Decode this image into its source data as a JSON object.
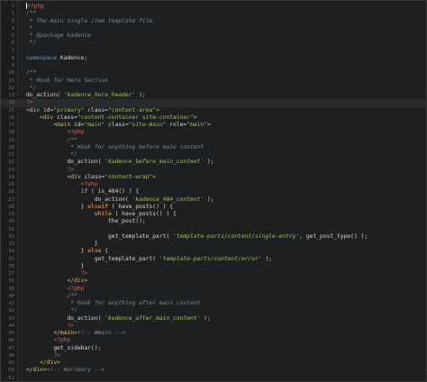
{
  "editor": {
    "lines": [
      {
        "n": "1",
        "parts": [
          {
            "c": "php",
            "t": "<?php"
          }
        ]
      },
      {
        "n": "2",
        "parts": [
          {
            "c": "cmt",
            "t": "/**"
          }
        ]
      },
      {
        "n": "3",
        "parts": [
          {
            "c": "cmt",
            "t": " * The main single item template file."
          }
        ]
      },
      {
        "n": "4",
        "parts": [
          {
            "c": "cmt",
            "t": " *"
          }
        ]
      },
      {
        "n": "5",
        "parts": [
          {
            "c": "cmt",
            "t": " * @package kadence"
          }
        ]
      },
      {
        "n": "6",
        "parts": [
          {
            "c": "cmt",
            "t": " */"
          }
        ]
      },
      {
        "n": "7",
        "parts": []
      },
      {
        "n": "8",
        "parts": [
          {
            "c": "ns",
            "t": "namespace"
          },
          {
            "c": "attr",
            "t": " Kadence;"
          }
        ]
      },
      {
        "n": "9",
        "parts": []
      },
      {
        "n": "10",
        "parts": [
          {
            "c": "cmt",
            "t": "/**"
          }
        ]
      },
      {
        "n": "11",
        "parts": [
          {
            "c": "cmt",
            "t": " * Hook for Hero Section"
          }
        ]
      },
      {
        "n": "12",
        "parts": [
          {
            "c": "cmt",
            "t": " */"
          }
        ]
      },
      {
        "n": "13",
        "parts": [
          {
            "c": "fn",
            "t": "do_action( "
          },
          {
            "c": "strfn",
            "t": "'kadence_hero_header'"
          },
          {
            "c": "fn",
            "t": " );"
          }
        ]
      },
      {
        "n": "14",
        "parts": [
          {
            "c": "php",
            "t": "?>"
          }
        ],
        "hl": true
      },
      {
        "n": "15",
        "parts": [
          {
            "c": "tag",
            "t": "<div "
          },
          {
            "c": "attr",
            "t": "id="
          },
          {
            "c": "str",
            "t": "\"primary\""
          },
          {
            "c": "attr",
            "t": " class="
          },
          {
            "c": "str",
            "t": "\"content-area\""
          },
          {
            "c": "tag",
            "t": ">"
          }
        ]
      },
      {
        "n": "16",
        "parts": [
          {
            "c": "attr",
            "t": "    "
          },
          {
            "c": "tag",
            "t": "<div "
          },
          {
            "c": "attr",
            "t": "class="
          },
          {
            "c": "str",
            "t": "\"content-container site-container\""
          },
          {
            "c": "tag",
            "t": ">"
          }
        ]
      },
      {
        "n": "17",
        "parts": [
          {
            "c": "attr",
            "t": "        "
          },
          {
            "c": "tag",
            "t": "<main "
          },
          {
            "c": "attr",
            "t": "id="
          },
          {
            "c": "str",
            "t": "\"main\""
          },
          {
            "c": "attr",
            "t": " class="
          },
          {
            "c": "str",
            "t": "\"site-main\""
          },
          {
            "c": "attr",
            "t": " role="
          },
          {
            "c": "str",
            "t": "\"main\""
          },
          {
            "c": "tag",
            "t": ">"
          }
        ]
      },
      {
        "n": "18",
        "parts": [
          {
            "c": "attr",
            "t": "            "
          },
          {
            "c": "php",
            "t": "<?php"
          }
        ]
      },
      {
        "n": "19",
        "parts": [
          {
            "c": "cmt",
            "t": "            /**"
          }
        ]
      },
      {
        "n": "20",
        "parts": [
          {
            "c": "cmt",
            "t": "             * Hook for anything before main content"
          }
        ]
      },
      {
        "n": "21",
        "parts": [
          {
            "c": "cmt",
            "t": "             */"
          }
        ]
      },
      {
        "n": "22",
        "parts": [
          {
            "c": "fn",
            "t": "            do_action( "
          },
          {
            "c": "strfn",
            "t": "'kadence_before_main_content'"
          },
          {
            "c": "fn",
            "t": " );"
          }
        ]
      },
      {
        "n": "23",
        "parts": [
          {
            "c": "attr",
            "t": "            "
          },
          {
            "c": "php",
            "t": "?>"
          }
        ]
      },
      {
        "n": "24",
        "parts": [
          {
            "c": "attr",
            "t": "            "
          },
          {
            "c": "tag",
            "t": "<div "
          },
          {
            "c": "attr",
            "t": "class="
          },
          {
            "c": "str",
            "t": "\"content-wrap\""
          },
          {
            "c": "tag",
            "t": ">"
          }
        ]
      },
      {
        "n": "25",
        "parts": [
          {
            "c": "attr",
            "t": "                "
          },
          {
            "c": "php",
            "t": "<?php"
          }
        ]
      },
      {
        "n": "26",
        "parts": [
          {
            "c": "attr",
            "t": "                "
          },
          {
            "c": "kw",
            "t": "if"
          },
          {
            "c": "fn",
            "t": " ( is_404() ) {"
          }
        ]
      },
      {
        "n": "27",
        "parts": [
          {
            "c": "fn",
            "t": "                    do_action( "
          },
          {
            "c": "strfn",
            "t": "'kadence_404_content'"
          },
          {
            "c": "fn",
            "t": " );"
          }
        ]
      },
      {
        "n": "28",
        "parts": [
          {
            "c": "fn",
            "t": "                } "
          },
          {
            "c": "kw",
            "t": "elseif"
          },
          {
            "c": "fn",
            "t": " ( have_posts() ) {"
          }
        ]
      },
      {
        "n": "29",
        "parts": [
          {
            "c": "attr",
            "t": "                    "
          },
          {
            "c": "kw",
            "t": "while"
          },
          {
            "c": "fn",
            "t": " ( have_posts() ) {"
          }
        ]
      },
      {
        "n": "30",
        "parts": [
          {
            "c": "fn",
            "t": "                        the_post();"
          }
        ]
      },
      {
        "n": "31",
        "parts": []
      },
      {
        "n": "32",
        "parts": [
          {
            "c": "fn",
            "t": "                        get_template_part( "
          },
          {
            "c": "strfn",
            "t": "'template-parts/content/single-entry'"
          },
          {
            "c": "fn",
            "t": ", get_post_type() );"
          }
        ]
      },
      {
        "n": "33",
        "parts": [
          {
            "c": "fn",
            "t": "                    }"
          }
        ]
      },
      {
        "n": "34",
        "parts": [
          {
            "c": "fn",
            "t": "                } "
          },
          {
            "c": "kw",
            "t": "else"
          },
          {
            "c": "fn",
            "t": " {"
          }
        ]
      },
      {
        "n": "35",
        "parts": [
          {
            "c": "fn",
            "t": "                    get_template_part( "
          },
          {
            "c": "strfn",
            "t": "'template-parts/content/error'"
          },
          {
            "c": "fn",
            "t": " );"
          }
        ]
      },
      {
        "n": "36",
        "parts": [
          {
            "c": "fn",
            "t": "                }"
          }
        ]
      },
      {
        "n": "37",
        "parts": [
          {
            "c": "attr",
            "t": "                "
          },
          {
            "c": "php",
            "t": "?>"
          }
        ]
      },
      {
        "n": "38",
        "parts": [
          {
            "c": "attr",
            "t": "            "
          },
          {
            "c": "tag",
            "t": "</div>"
          }
        ]
      },
      {
        "n": "39",
        "parts": [
          {
            "c": "attr",
            "t": "            "
          },
          {
            "c": "php",
            "t": "<?php"
          }
        ]
      },
      {
        "n": "40",
        "parts": [
          {
            "c": "cmt",
            "t": "            /**"
          }
        ]
      },
      {
        "n": "41",
        "parts": [
          {
            "c": "cmt",
            "t": "             * Hook for anything after main content"
          }
        ]
      },
      {
        "n": "42",
        "parts": [
          {
            "c": "cmt",
            "t": "             */"
          }
        ]
      },
      {
        "n": "43",
        "parts": [
          {
            "c": "fn",
            "t": "            do_action( "
          },
          {
            "c": "strfn",
            "t": "'kadence_after_main_content'"
          },
          {
            "c": "fn",
            "t": " );"
          }
        ]
      },
      {
        "n": "44",
        "parts": [
          {
            "c": "attr",
            "t": "            "
          },
          {
            "c": "php",
            "t": "?>"
          }
        ]
      },
      {
        "n": "45",
        "parts": [
          {
            "c": "attr",
            "t": "        "
          },
          {
            "c": "tag",
            "t": "</main>"
          },
          {
            "c": "cmt",
            "t": "<!-- #main -->"
          }
        ]
      },
      {
        "n": "46",
        "parts": [
          {
            "c": "attr",
            "t": "        "
          },
          {
            "c": "php",
            "t": "<?php"
          }
        ]
      },
      {
        "n": "47",
        "parts": [
          {
            "c": "fn",
            "t": "        get_sidebar();"
          }
        ]
      },
      {
        "n": "48",
        "parts": [
          {
            "c": "attr",
            "t": "        "
          },
          {
            "c": "php",
            "t": "?>"
          }
        ]
      },
      {
        "n": "49",
        "parts": [
          {
            "c": "attr",
            "t": "    "
          },
          {
            "c": "tag",
            "t": "</div>"
          }
        ]
      },
      {
        "n": "50",
        "parts": [
          {
            "c": "tag",
            "t": "</div>"
          },
          {
            "c": "cmt",
            "t": "<!-- #primary -->"
          }
        ]
      },
      {
        "n": "51",
        "parts": []
      }
    ]
  }
}
